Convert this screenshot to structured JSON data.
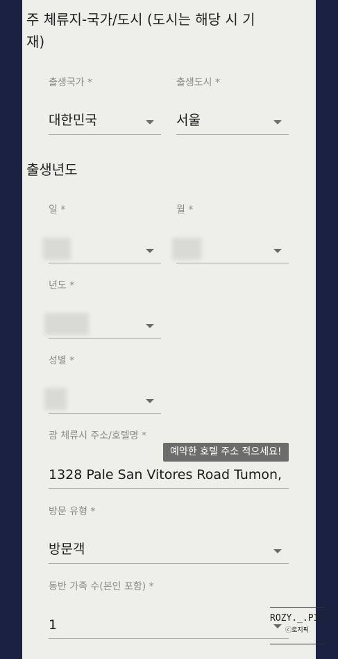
{
  "section1": {
    "title": "주 체류지-국가/도시 (도시는 해당 시 기재)"
  },
  "birth_country": {
    "label": "출생국가 *",
    "value": "대한민국"
  },
  "birth_city": {
    "label": "출생도시 *",
    "value": "서울"
  },
  "section2": {
    "title": "출생년도"
  },
  "day": {
    "label": "일 *"
  },
  "month": {
    "label": "월 *"
  },
  "year": {
    "label": "년도 *"
  },
  "gender": {
    "label": "성별 *"
  },
  "address": {
    "label": "괌 체류시 주소/호텔명 *",
    "value": "1328 Pale San Vitores Road Tumon,",
    "tooltip": "예약한 호텔 주소 적으세요!"
  },
  "visit_type": {
    "label": "방문 유형 *",
    "value": "방문객"
  },
  "family": {
    "label": "동반 가족 수(본인 포함) *",
    "value": "1"
  },
  "watermark": {
    "main": "ROZY._.PIC",
    "sub": "ⓒ로지픽"
  },
  "colors": {
    "background": "#1b2140",
    "panel": "#efefea",
    "tooltip": "#6c6c6a"
  }
}
